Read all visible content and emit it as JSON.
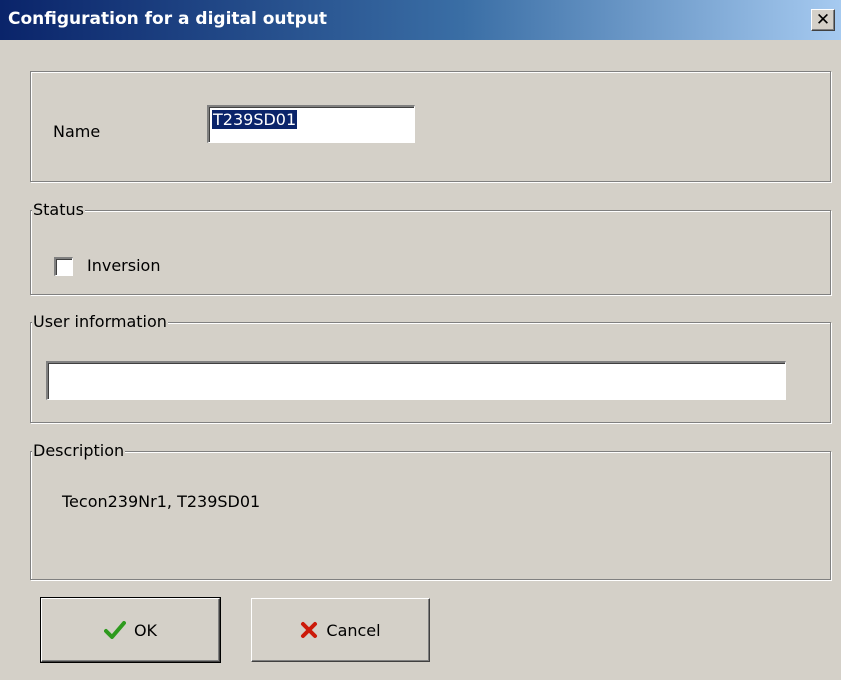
{
  "window": {
    "title": "Configuration for a digital output",
    "close_glyph": "✕"
  },
  "name_section": {
    "label": "Name",
    "value": "T239SD01"
  },
  "status_section": {
    "legend": "Status",
    "inversion_label": "Inversion",
    "inversion_checked": false
  },
  "user_info_section": {
    "legend": "User information",
    "value": ""
  },
  "description_section": {
    "legend": "Description",
    "text": "Tecon239Nr1, T239SD01"
  },
  "buttons": {
    "ok_label": "OK",
    "ok_icon": "checkmark-icon",
    "cancel_label": "Cancel",
    "cancel_icon": "x-mark-icon"
  },
  "colors": {
    "titlebar_start": "#0a246a",
    "titlebar_end": "#a6caf0",
    "face": "#d4d0c8",
    "ok_icon": "#2e9a1e",
    "cancel_icon": "#cc1a0a"
  }
}
